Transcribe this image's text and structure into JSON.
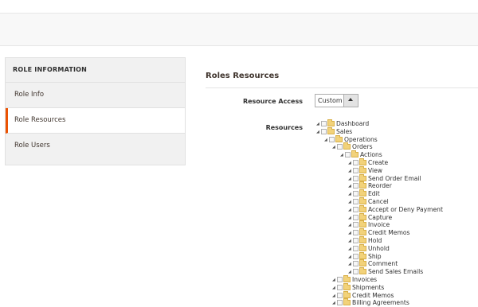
{
  "sidebar": {
    "title": "ROLE INFORMATION",
    "items": [
      {
        "label": "Role Info",
        "active": false
      },
      {
        "label": "Role Resources",
        "active": true
      },
      {
        "label": "Role Users",
        "active": false
      }
    ]
  },
  "main": {
    "title": "Roles Resources",
    "resource_access_label": "Resource Access",
    "resource_access_value": "Custom",
    "resources_label": "Resources"
  },
  "tree": [
    {
      "label": "Dashboard",
      "level": 0
    },
    {
      "label": "Sales",
      "level": 0
    },
    {
      "label": "Operations",
      "level": 1
    },
    {
      "label": "Orders",
      "level": 2
    },
    {
      "label": "Actions",
      "level": 3
    },
    {
      "label": "Create",
      "level": 4
    },
    {
      "label": "View",
      "level": 4
    },
    {
      "label": "Send Order Email",
      "level": 4
    },
    {
      "label": "Reorder",
      "level": 4
    },
    {
      "label": "Edit",
      "level": 4
    },
    {
      "label": "Cancel",
      "level": 4
    },
    {
      "label": "Accept or Deny Payment",
      "level": 4
    },
    {
      "label": "Capture",
      "level": 4
    },
    {
      "label": "Invoice",
      "level": 4
    },
    {
      "label": "Credit Memos",
      "level": 4
    },
    {
      "label": "Hold",
      "level": 4
    },
    {
      "label": "Unhold",
      "level": 4
    },
    {
      "label": "Ship",
      "level": 4
    },
    {
      "label": "Comment",
      "level": 4
    },
    {
      "label": "Send Sales Emails",
      "level": 4
    },
    {
      "label": "Invoices",
      "level": 2
    },
    {
      "label": "Shipments",
      "level": 2
    },
    {
      "label": "Credit Memos",
      "level": 2
    },
    {
      "label": "Billing Agreements",
      "level": 2
    }
  ],
  "colors": {
    "accent": "#eb5202",
    "sidebar_bg": "#f1f1f1"
  }
}
